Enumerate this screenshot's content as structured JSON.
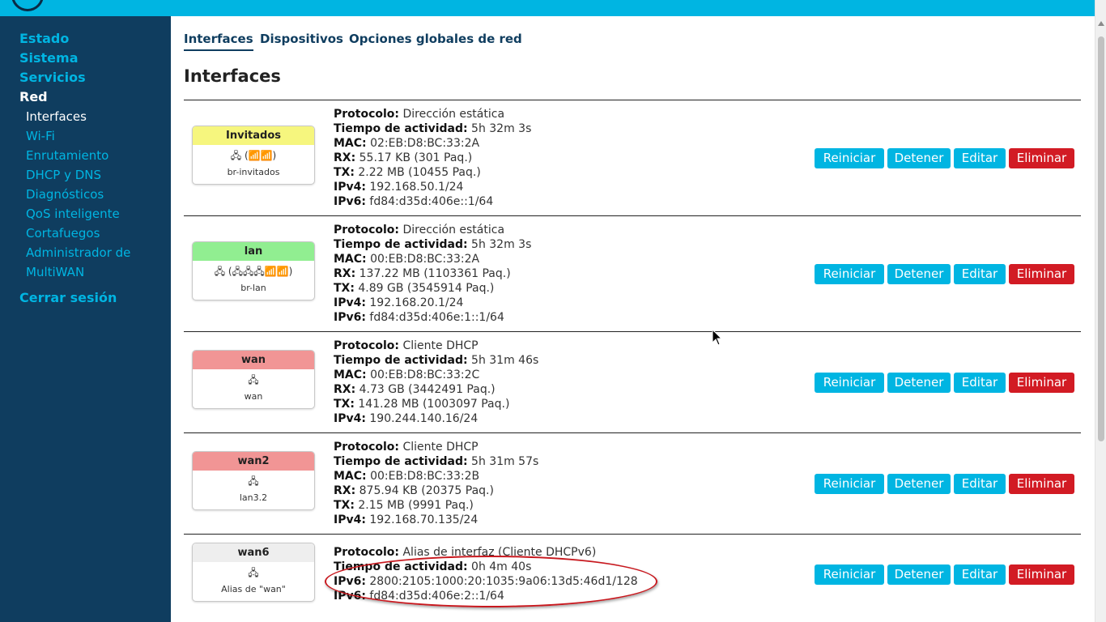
{
  "colors": {
    "accent": "#00b5e2",
    "sidebar_bg": "#0f3d5f",
    "danger": "#d21b24",
    "badge_yellow": "#f6f67e",
    "badge_green": "#91ee91",
    "badge_red": "#f19595",
    "badge_gray": "#eeeeee",
    "highlight_ring": "#c8181e"
  },
  "sidebar": {
    "main": [
      "Estado",
      "Sistema",
      "Servicios",
      "Red"
    ],
    "sub": [
      "Interfaces",
      "Wi-Fi",
      "Enrutamiento",
      "DHCP y DNS",
      "Diagnósticos",
      "QoS inteligente",
      "Cortafuegos",
      "Administrador de",
      "MultiWAN"
    ],
    "logout": "Cerrar sesión"
  },
  "tabs": [
    "Interfaces",
    "Dispositivos",
    "Opciones globales de red"
  ],
  "page_title": "Interfaces",
  "buttons": {
    "restart": "Reiniciar",
    "stop": "Detener",
    "edit": "Editar",
    "delete": "Eliminar"
  },
  "interfaces": [
    {
      "name": "Invitados",
      "icons": "🖧 (📶📶)",
      "device": "br-invitados",
      "color": "yellow",
      "lines": [
        {
          "label": "Protocolo:",
          "value": " Dirección estática"
        },
        {
          "label": "Tiempo de actividad:",
          "value": " 5h 32m 3s"
        },
        {
          "label": "MAC:",
          "value": " 02:EB:D8:BC:33:2A"
        },
        {
          "label": "RX:",
          "value": " 55.17 KB (301 Paq.)"
        },
        {
          "label": "TX:",
          "value": " 2.22 MB (10455 Paq.)"
        },
        {
          "label": "IPv4:",
          "value": " 192.168.50.1/24"
        },
        {
          "label": "IPv6:",
          "value": " fd84:d35d:406e::1/64"
        }
      ]
    },
    {
      "name": "lan",
      "icons": "🖧 (🖧🖧🖧📶📶)",
      "device": "br-lan",
      "color": "green",
      "lines": [
        {
          "label": "Protocolo:",
          "value": " Dirección estática"
        },
        {
          "label": "Tiempo de actividad:",
          "value": " 5h 32m 3s"
        },
        {
          "label": "MAC:",
          "value": " 00:EB:D8:BC:33:2A"
        },
        {
          "label": "RX:",
          "value": " 137.22 MB (1103361 Paq.)"
        },
        {
          "label": "TX:",
          "value": " 4.89 GB (3545914 Paq.)"
        },
        {
          "label": "IPv4:",
          "value": " 192.168.20.1/24"
        },
        {
          "label": "IPv6:",
          "value": " fd84:d35d:406e:1::1/64"
        }
      ]
    },
    {
      "name": "wan",
      "icons": "🖧",
      "device": "wan",
      "color": "red",
      "lines": [
        {
          "label": "Protocolo:",
          "value": " Cliente DHCP"
        },
        {
          "label": "Tiempo de actividad:",
          "value": " 5h 31m 46s"
        },
        {
          "label": "MAC:",
          "value": " 00:EB:D8:BC:33:2C"
        },
        {
          "label": "RX:",
          "value": " 4.73 GB (3442491 Paq.)"
        },
        {
          "label": "TX:",
          "value": " 141.28 MB (1003097 Paq.)"
        },
        {
          "label": "IPv4:",
          "value": " 190.244.140.16/24"
        }
      ]
    },
    {
      "name": "wan2",
      "icons": "🖧",
      "device": "lan3.2",
      "color": "red",
      "lines": [
        {
          "label": "Protocolo:",
          "value": " Cliente DHCP"
        },
        {
          "label": "Tiempo de actividad:",
          "value": " 5h 31m 57s"
        },
        {
          "label": "MAC:",
          "value": " 00:EB:D8:BC:33:2B"
        },
        {
          "label": "RX:",
          "value": " 875.94 KB (20375 Paq.)"
        },
        {
          "label": "TX:",
          "value": " 2.15 MB (9991 Paq.)"
        },
        {
          "label": "IPv4:",
          "value": " 192.168.70.135/24"
        }
      ]
    },
    {
      "name": "wan6",
      "icons": "🖧",
      "device": "Alias de \"wan\"",
      "color": "gray",
      "lines": [
        {
          "label": "Protocolo:",
          "value": " Alias de interfaz (Cliente DHCPv6)"
        },
        {
          "label": "Tiempo de actividad:",
          "value": " 0h 4m 40s"
        },
        {
          "label": "IPv6:",
          "value": " 2800:2105:1000:20:1035:9a06:13d5:46d1/128"
        },
        {
          "label": "IPv6:",
          "value": " fd84:d35d:406e:2::1/64"
        }
      ]
    }
  ]
}
